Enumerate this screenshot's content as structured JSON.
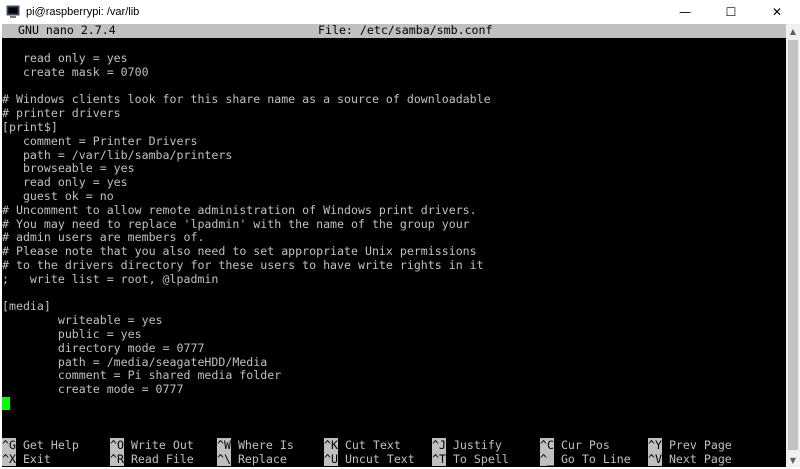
{
  "window": {
    "title": "pi@raspberrypi: /var/lib",
    "minimize": "—",
    "maximize": "☐",
    "close": "✕"
  },
  "nano": {
    "version": "GNU nano 2.7.4",
    "file": "File: /etc/samba/smb.conf"
  },
  "lines": [
    "   read only = yes",
    "   create mask = 0700",
    "",
    "# Windows clients look for this share name as a source of downloadable",
    "# printer drivers",
    "[print$]",
    "   comment = Printer Drivers",
    "   path = /var/lib/samba/printers",
    "   browseable = yes",
    "   read only = yes",
    "   guest ok = no",
    "# Uncomment to allow remote administration of Windows print drivers.",
    "# You may need to replace 'lpadmin' with the name of the group your",
    "# admin users are members of.",
    "# Please note that you also need to set appropriate Unix permissions",
    "# to the drivers directory for these users to have write rights in it",
    ";   write list = root, @lpadmin",
    "",
    "[media]",
    "        writeable = yes",
    "        public = yes",
    "        directory mode = 0777",
    "        path = /media/seagateHDD/Media",
    "        comment = Pi shared media folder",
    "        create mode = 0777"
  ],
  "shortcuts": {
    "row1": [
      {
        "key": "^G",
        "label": "Get Help"
      },
      {
        "key": "^O",
        "label": "Write Out"
      },
      {
        "key": "^W",
        "label": "Where Is"
      },
      {
        "key": "^K",
        "label": "Cut Text"
      },
      {
        "key": "^J",
        "label": "Justify"
      },
      {
        "key": "^C",
        "label": "Cur Pos"
      },
      {
        "key": "^Y",
        "label": "Prev Page"
      }
    ],
    "row2": [
      {
        "key": "^X",
        "label": "Exit"
      },
      {
        "key": "^R",
        "label": "Read File"
      },
      {
        "key": "^\\",
        "label": "Replace"
      },
      {
        "key": "^U",
        "label": "Uncut Text"
      },
      {
        "key": "^T",
        "label": "To Spell"
      },
      {
        "key": "^_",
        "label": "Go To Line"
      },
      {
        "key": "^V",
        "label": "Next Page"
      }
    ]
  },
  "colors": {
    "terminal_bg": "#000000",
    "terminal_fg": "#c0c0c0",
    "cursor": "#00ff00"
  }
}
